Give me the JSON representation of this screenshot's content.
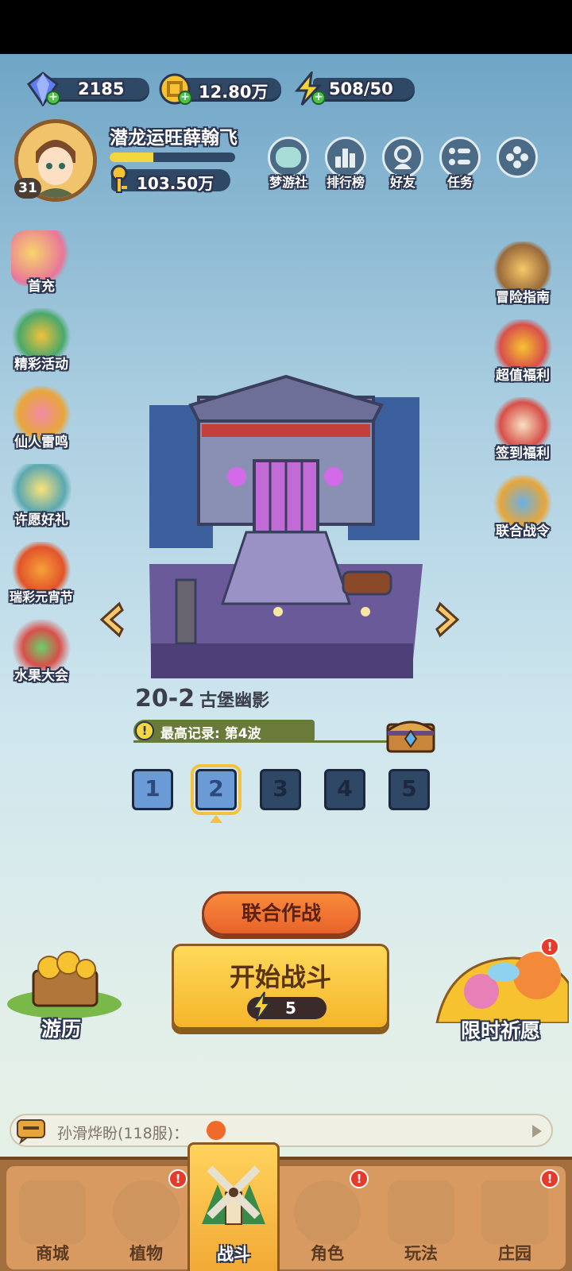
{
  "currency": {
    "gems": "2185",
    "gold": "12.80万",
    "energy": "508/50"
  },
  "player": {
    "level": "31",
    "name": "潜龙运旺薛翰飞",
    "keys": "103.50万",
    "xp_fraction": 0.35
  },
  "top_nav": [
    "梦游社",
    "排行榜",
    "好友",
    "任务"
  ],
  "left_side": [
    "首充",
    "精彩活动",
    "仙人雷鸣",
    "许愿好礼",
    "瑞彩元宵节",
    "水果大会"
  ],
  "right_side": [
    "冒险指南",
    "超值福利",
    "签到福利",
    "联合战令"
  ],
  "stage": {
    "number": "20-2",
    "name": "古堡幽影",
    "record": "最高记录: 第4波",
    "waves": [
      "1",
      "2",
      "3",
      "4",
      "5"
    ],
    "current_wave": 2
  },
  "buttons": {
    "coop": "联合作战",
    "start": "开始战斗",
    "start_cost": "5",
    "travel": "游历",
    "wish": "限时祈愿"
  },
  "chat": {
    "message": "孙滑烨盼(118服)："
  },
  "bottom_nav": [
    "商城",
    "植物",
    "战斗",
    "角色",
    "玩法",
    "庄园"
  ],
  "colors": {
    "panel": "#2f4866",
    "accent_yellow": "#f4d640",
    "start_button": "#f5b52a",
    "coop_button": "#e8622a",
    "badge_red": "#e63a2a"
  }
}
